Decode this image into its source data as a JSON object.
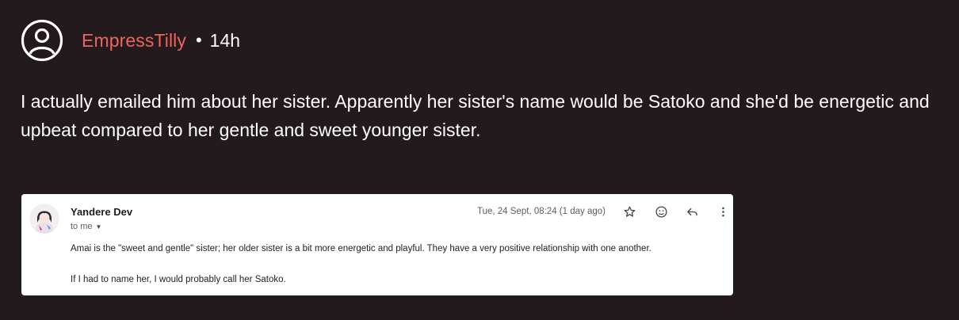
{
  "post": {
    "username": "EmpressTilly",
    "separator": "•",
    "time": "14h",
    "body": "I actually emailed him about her sister. Apparently her sister's name would be Satoko and she'd be energetic and upbeat compared to her gentle and sweet younger sister."
  },
  "email": {
    "sender": "Yandere Dev",
    "recipient": "to me",
    "date": "Tue, 24 Sept, 08:24 (1 day ago)",
    "lines": [
      "Amai is the \"sweet and gentle\" sister; her older sister is a bit more energetic and playful. They have a very positive relationship with one another.",
      "If I had to name her, I would probably call her Satoko."
    ],
    "icons": [
      "star-icon",
      "emoji-icon",
      "reply-icon",
      "more-vert-icon"
    ]
  },
  "colors": {
    "background": "#221a1d",
    "username": "#f0645c",
    "text": "#ffffff",
    "card": "#ffffff"
  }
}
